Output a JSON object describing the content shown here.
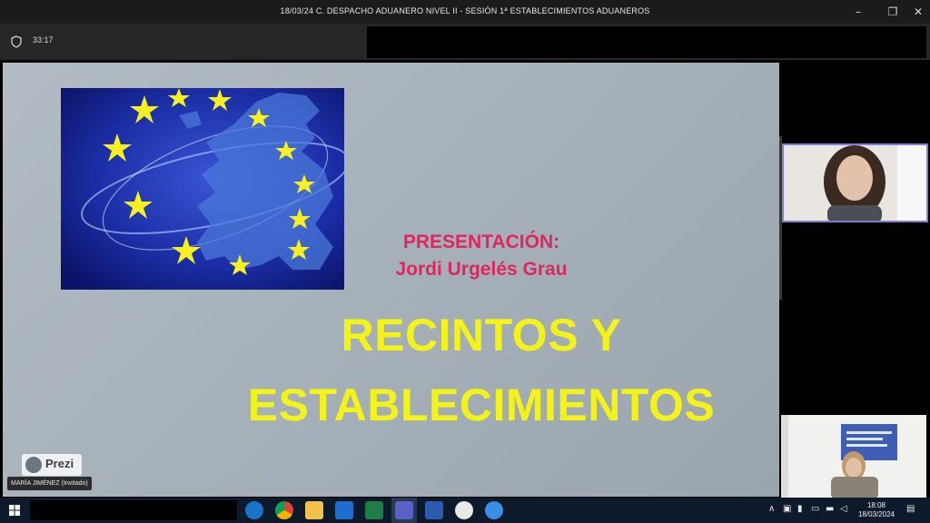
{
  "window": {
    "title": "18/03/24 C. DESPACHO ADUANERO NIVEL II - SESIÓN 1ª ESTABLECIMIENTOS ADUANEROS",
    "controls": [
      "minimize-icon",
      "restore-icon",
      "close-icon"
    ]
  },
  "meeting": {
    "timer": "33:17"
  },
  "slide": {
    "presenter_heading": "PRESENTACIÓN:",
    "presenter_name": "Jordi Urgelés Grau",
    "title_line1": "RECINTOS Y",
    "title_line2": "ESTABLECIMIENTOS",
    "image": "eu-map-stars-image",
    "brand": "Prezi",
    "colors": {
      "accent_pink": "#e0265f",
      "title_yellow": "#f3f31a"
    }
  },
  "participants": [
    {
      "name": "MARÍA JIMÉNEZ (Invitado)"
    }
  ],
  "taskbar": {
    "apps": [
      "edge-icon",
      "chrome-icon",
      "file-explorer-icon",
      "outlook-icon",
      "excel-icon",
      "teams-icon",
      "word-icon",
      "paint-icon",
      "app-icon"
    ],
    "clock_time": "18:08",
    "clock_date": "18/03/2024"
  }
}
